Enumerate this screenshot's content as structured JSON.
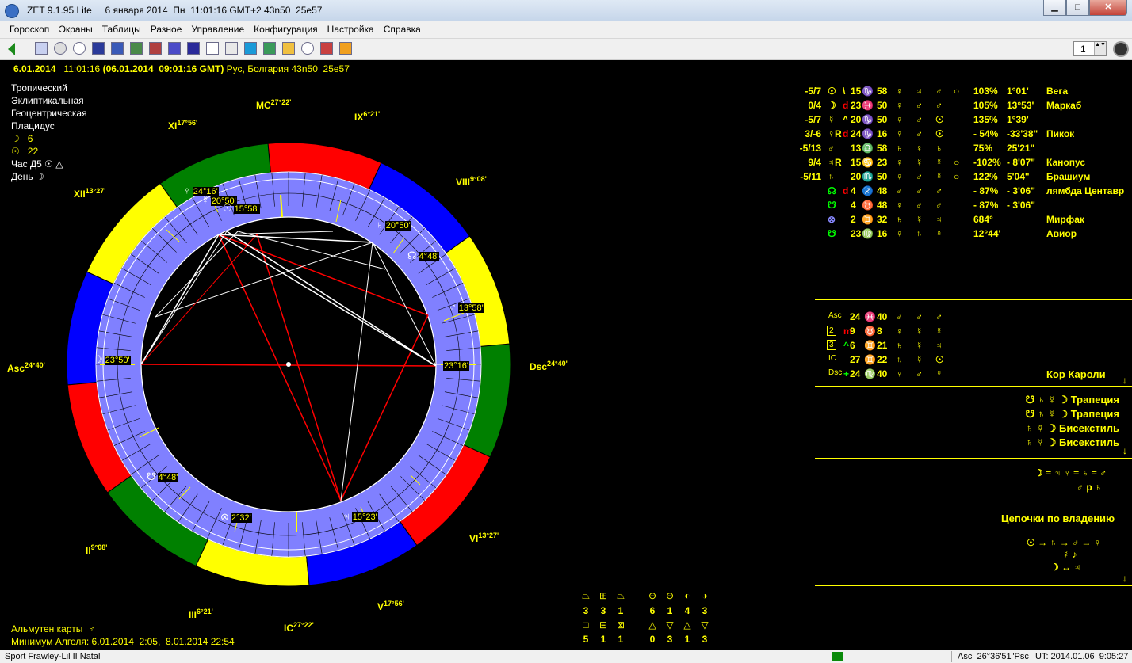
{
  "window": {
    "title": "ZET 9.1.95 Lite     6 января 2014  Пн  11:01:16 GMT+2 43n50  25e57",
    "min": "▁",
    "max": "□",
    "close": "✕"
  },
  "menu": [
    "Гороскоп",
    "Экраны",
    "Таблицы",
    "Разное",
    "Управление",
    "Конфигурация",
    "Настройка",
    "Справка"
  ],
  "toolbar": {
    "spin_value": "1",
    "spin_arrows": "▲▼"
  },
  "header": {
    "date": "6.01.2014",
    "time": "11:01:16",
    "gmt": "(06.01.2014  09:01:16 GMT)",
    "place": "Рус, Болгария 43n50  25e57"
  },
  "settings": [
    "Тропический",
    "Эклиптикальная",
    "Геоцентрическая",
    "Плацидус"
  ],
  "moon_row": {
    "glyph": "☽",
    "value": "6"
  },
  "sun_row": {
    "glyph": "☉",
    "value": "22"
  },
  "hour_label": "Час Д5 ☉ △",
  "day_label": "День ☽",
  "houses": {
    "MC": {
      "name": "MC",
      "deg": "27°22'"
    },
    "IX": {
      "name": "IX",
      "deg": "6°21'"
    },
    "VIII": {
      "name": "VIII",
      "deg": "9°08'"
    },
    "XI": {
      "name": "XI",
      "deg": "17°56'"
    },
    "XII": {
      "name": "XII",
      "deg": "13°27'"
    },
    "Asc": {
      "name": "Asc",
      "deg": "24°40'"
    },
    "Dsc": {
      "name": "Dsc",
      "deg": "24°40'"
    },
    "II": {
      "name": "II",
      "deg": "9°08'"
    },
    "III": {
      "name": "III",
      "deg": "6°21'"
    },
    "IC": {
      "name": "IC",
      "deg": "27°22'"
    },
    "V": {
      "name": "V",
      "deg": "17°56'"
    },
    "VI": {
      "name": "VI",
      "deg": "13°27'"
    }
  },
  "chart_planets": [
    {
      "glyph": "♀",
      "deg": "24°16'"
    },
    {
      "glyph": "☿",
      "deg": "20°50'"
    },
    {
      "glyph": "☉",
      "deg": "15°58'"
    },
    {
      "glyph": "♄",
      "deg": "20°50'"
    },
    {
      "glyph": "☊",
      "deg": "4°48'"
    },
    {
      "glyph": "♂",
      "deg": "13°58'"
    },
    {
      "glyph": "☽",
      "deg": "23°50'"
    },
    {
      "glyph": "",
      "deg": "23°16'"
    },
    {
      "glyph": "☋",
      "deg": "4°48'"
    },
    {
      "glyph": "⊗",
      "deg": "2°32'"
    },
    {
      "glyph": "♃",
      "deg": "15°23'"
    }
  ],
  "planets": [
    {
      "score": "-5/7",
      "glyph": "☉",
      "mark": "\\",
      "deg": "15",
      "sign": "♑",
      "min": "58",
      "r1": "♀",
      "r2": "♃",
      "r3": "♂",
      "r4": "○",
      "pct": "103%",
      "orb": "1°01'",
      "star": "Вега"
    },
    {
      "score": "0/4",
      "glyph": "☽",
      "mark": "d",
      "deg": "23",
      "sign": "♓",
      "min": "50",
      "r1": "♀",
      "r2": "♂",
      "r3": "♂",
      "r4": "",
      "pct": "105%",
      "orb": "13°53'",
      "star": "Маркаб"
    },
    {
      "score": "-5/7",
      "glyph": "☿",
      "mark": "^",
      "deg": "20",
      "sign": "♑",
      "min": "50",
      "r1": "♀",
      "r2": "♂",
      "r3": "☉",
      "r4": "",
      "pct": "135%",
      "orb": "1°39'",
      "star": ""
    },
    {
      "score": "3/-6",
      "glyph": "♀R",
      "mark": "d",
      "deg": "24",
      "sign": "♑",
      "min": "16",
      "r1": "♀",
      "r2": "♂",
      "r3": "☉",
      "r4": "",
      "pct": "- 54%",
      "orb": "-33'38\"",
      "star": "Пикок"
    },
    {
      "score": "-5/13",
      "glyph": "♂",
      "mark": "",
      "deg": "13",
      "sign": "♎",
      "min": "58",
      "r1": "♄",
      "r2": "♀",
      "r3": "♄",
      "r4": "",
      "pct": "75%",
      "orb": "25'21\"",
      "star": ""
    },
    {
      "score": "9/4",
      "glyph": "♃R",
      "mark": "",
      "deg": "15",
      "sign": "♋",
      "min": "23",
      "r1": "♀",
      "r2": "☿",
      "r3": "☿",
      "r4": "○",
      "pct": "-102%",
      "orb": "- 8'07\"",
      "star": "Канопус"
    },
    {
      "score": "-5/11",
      "glyph": "♄",
      "mark": "",
      "deg": "20",
      "sign": "♏",
      "min": "50",
      "r1": "♀",
      "r2": "♂",
      "r3": "☿",
      "r4": "○",
      "pct": "122%",
      "orb": "5'04\"",
      "star": "Брашиум"
    },
    {
      "score": "",
      "glyph": "☊",
      "mark": "d",
      "deg": "4",
      "sign": "♐",
      "min": "48",
      "r1": "♂",
      "r2": "♂",
      "r3": "♂",
      "r4": "",
      "pct": "- 87%",
      "orb": "- 3'06\"",
      "star": "лямбда Центавр"
    },
    {
      "score": "",
      "glyph": "☋",
      "mark": "",
      "deg": "4",
      "sign": "♉",
      "min": "48",
      "r1": "♀",
      "r2": "♂",
      "r3": "♂",
      "r4": "",
      "pct": "- 87%",
      "orb": "- 3'06\"",
      "star": ""
    },
    {
      "score": "",
      "glyph": "⊗",
      "mark": "",
      "deg": "2",
      "sign": "♊",
      "min": "32",
      "r1": "♄",
      "r2": "☿",
      "r3": "♃",
      "r4": "",
      "pct": "684°",
      "orb": "",
      "star": "Мирфак"
    },
    {
      "score": "",
      "glyph": "☋",
      "mark": "",
      "deg": "23",
      "sign": "♍",
      "min": "16",
      "r1": "♀",
      "r2": "♄",
      "r3": "☿",
      "r4": "",
      "pct": "12°44'",
      "orb": "",
      "star": "Авиор"
    }
  ],
  "angles": [
    {
      "name": "Asc",
      "mark": "",
      "deg": "24",
      "sign": "♓",
      "min": "40",
      "r1": "♂",
      "r2": "♂",
      "r3": "♂"
    },
    {
      "name": "2",
      "mark": "m",
      "deg": "9",
      "sign": "♉",
      "min": "8",
      "r1": "♀",
      "r2": "☿",
      "r3": "☿"
    },
    {
      "name": "3",
      "mark": "^",
      "deg": "6",
      "sign": "♊",
      "min": "21",
      "r1": "♄",
      "r2": "☿",
      "r3": "♃"
    },
    {
      "name": "IC",
      "mark": "",
      "deg": "27",
      "sign": "♊",
      "min": "22",
      "r1": "♄",
      "r2": "☿",
      "r3": "☉"
    },
    {
      "name": "Dsc",
      "mark": "+",
      "deg": "24",
      "sign": "♍",
      "min": "40",
      "r1": "♀",
      "r2": "♂",
      "r3": "☿"
    }
  ],
  "kor_caroli": "Кор Кароли",
  "configs": [
    {
      "glyphs": "☋ ♄ ☿ ☽",
      "name": "Трапеция"
    },
    {
      "glyphs": "☋ ♄ ☿ ☽",
      "name": "Трапеция"
    },
    {
      "glyphs": "♄ ☿ ☽",
      "name": "Бисекстиль"
    },
    {
      "glyphs": "♄ ☿ ☽",
      "name": "Бисекстиль"
    }
  ],
  "equal1": "☽ = ♃  ♀ = ♄ = ♂",
  "equal2": "♂ p ♄",
  "chains_title": "Цепочки по владению",
  "chain1": "☉ → ♄ → ♂ → ♀",
  "chain2": "☿ ♪",
  "chain3": "☽ ↔ ♃",
  "almuten": "Альмутен карты  ♂",
  "algol": "Минимум Алголя: 6.01.2014  2:05,  8.01.2014 22:54",
  "stats_top": [
    "3",
    "3",
    "1",
    "6",
    "1",
    "4",
    "3"
  ],
  "stats_bottom": [
    "5",
    "1",
    "1",
    "0",
    "3",
    "1",
    "3"
  ],
  "stats_icons_top": [
    "⏢",
    "⊞",
    "⏢",
    "⊖",
    "⊖",
    "◐",
    "◑"
  ],
  "stats_icons_bottom": [
    "□",
    "⊟",
    "⊠",
    "△",
    "▽",
    "△",
    "▽"
  ],
  "status": {
    "left": "Sport Frawley-Lil II Natal",
    "asc": "Asc  26°36'51\"Psc",
    "ut": "UT: 2014.01.06  9:05:27"
  },
  "colors": {
    "fire": "#ff0000",
    "earth": "#008000",
    "air": "#ffff00",
    "water": "#0000ff",
    "inner_ring": "#8080ff",
    "text": "#ffff00"
  }
}
